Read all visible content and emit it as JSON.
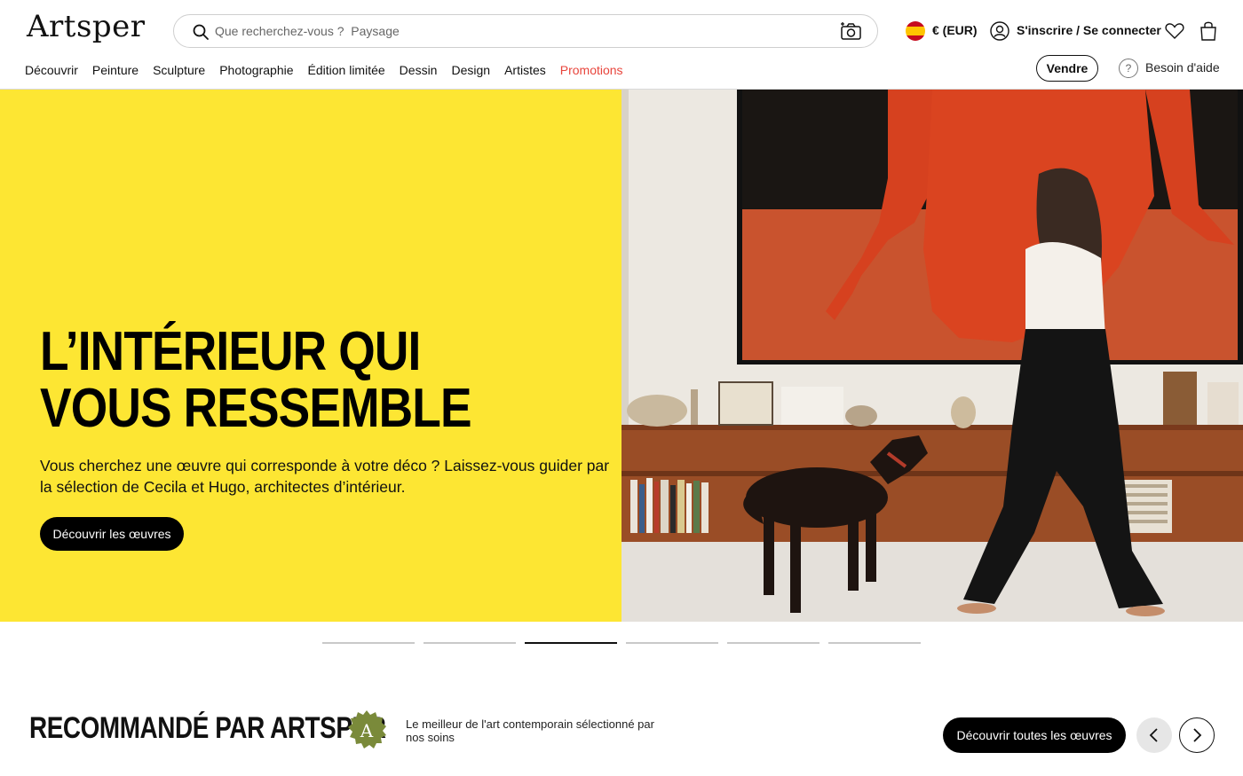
{
  "header": {
    "logo": "Artsper",
    "search_placeholder": "Que recherchez-vous ?  Paysage",
    "currency": "€ (EUR)",
    "login": "S'inscrire / Se connecter",
    "sell": "Vendre",
    "help": "Besoin d'aide"
  },
  "nav": {
    "items": [
      "Découvrir",
      "Peinture",
      "Sculpture",
      "Photographie",
      "Édition limitée",
      "Dessin",
      "Design",
      "Artistes"
    ],
    "promo": "Promotions"
  },
  "hero": {
    "title": "L’INTÉRIEUR QUI VOUS RESSEMBLE",
    "subtitle": "Vous cherchez une œuvre qui corresponde à votre déco ? Laissez-vous guider par la sélection de Cecila et Hugo, architectes d’intérieur.",
    "cta": "Découvrir les œuvres",
    "slides_total": 6,
    "active_slide": 3
  },
  "recommended": {
    "title": "RECOMMANDÉ PAR ARTSPER",
    "badge": "A",
    "description": "Le meilleur de l'art contemporain sélectionné par nos soins",
    "cta": "Découvrir toutes les œuvres"
  },
  "colors": {
    "hero_yellow": "#fde633",
    "promo_red": "#e8453c",
    "badge_green": "#7a8a3a"
  },
  "icons": [
    "search-icon",
    "camera-icon",
    "spain-flag-icon",
    "user-icon",
    "heart-icon",
    "bag-icon",
    "question-icon",
    "chevron-left-icon",
    "chevron-right-icon"
  ]
}
